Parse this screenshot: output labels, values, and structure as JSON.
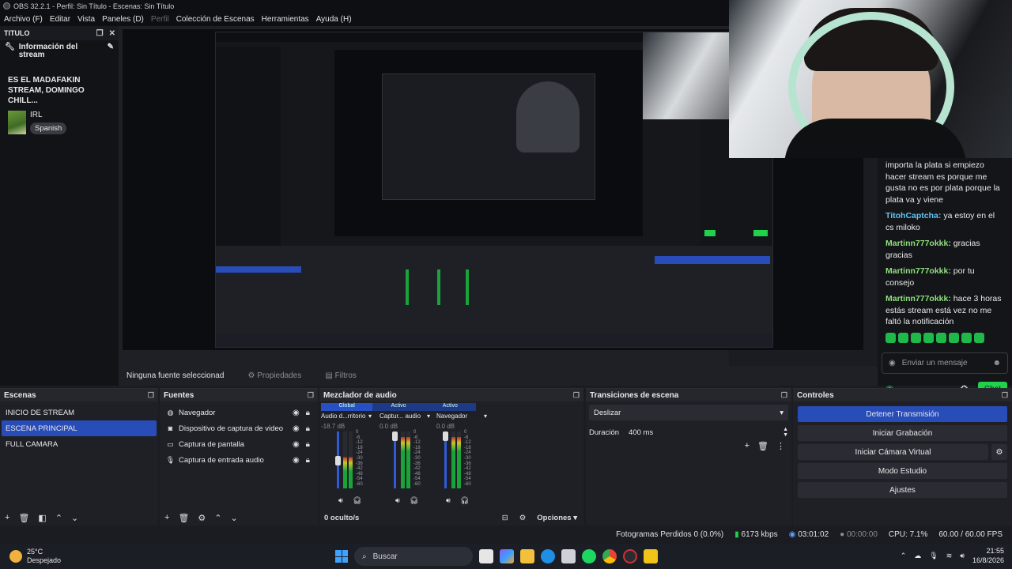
{
  "titlebar": {
    "title": "OBS 32.2.1 - Perfil: Sin Título - Escenas: Sin Título"
  },
  "menu": [
    "Archivo (F)",
    "Editar",
    "Vista",
    "Paneles (D)",
    "Perfil",
    "Colección de Escenas",
    "Herramientas",
    "Ayuda (H)"
  ],
  "leftdock": {
    "header": "TITULO",
    "info_title": "Información del stream",
    "stream_title": "ES EL MADAFAKIN STREAM, DOMINGO CHILL...",
    "category": "IRL",
    "language": "Spanish"
  },
  "chat": {
    "messages": [
      {
        "user": "",
        "text": "importa la plata si empiezo hacer stream es porque me gusta no es por plata porque la plata va y viene"
      },
      {
        "user": "TitohCaptcha",
        "text": "ya estoy en el cs miloko",
        "color": "#61c3f0"
      },
      {
        "user": "Martinn777okkk",
        "text": "gracias gracias"
      },
      {
        "user": "Martinn777okkk",
        "text": "por tu consejo"
      },
      {
        "user": "Martinn777okkk",
        "text": "hace 3 horas estás stream está vez no me faltó la notificación"
      }
    ],
    "input_placeholder": "Enviar un mensaje",
    "chat_button": "Chat"
  },
  "subbar": {
    "no_source": "Ninguna fuente seleccionad",
    "properties": "Propiedades",
    "filters": "Filtros"
  },
  "scenes": {
    "title": "Escenas",
    "items": [
      "INICIO DE STREAM",
      "ESCENA PRINCIPAL",
      "FULL CAMARA"
    ],
    "selected": "ESCENA PRINCIPAL"
  },
  "sources": {
    "title": "Fuentes",
    "items": [
      {
        "label": "Navegador",
        "icon": "globe-icon"
      },
      {
        "label": "Dispositivo de captura de video",
        "icon": "camera-icon"
      },
      {
        "label": "Captura de pantalla",
        "icon": "monitor-icon"
      },
      {
        "label": "Captura de entrada audio",
        "icon": "mic-icon"
      }
    ]
  },
  "mixer": {
    "title": "Mezclador de audio",
    "tabs": [
      "Global",
      "Activo",
      "Activo"
    ],
    "channels": [
      {
        "name": "Audio d...rritorio",
        "db": "-18.7 dB",
        "level": 0.55
      },
      {
        "name": "Captur... audio",
        "db": "0.0 dB",
        "level": 0.9
      },
      {
        "name": "Navegador",
        "db": "0.0 dB",
        "level": 0.9
      }
    ],
    "ticks": [
      "0",
      "-6",
      "-12",
      "-18",
      "-24",
      "-30",
      "-36",
      "-42",
      "-48",
      "-54",
      "-60"
    ],
    "hidden": "0 oculto/s",
    "options": "Opciones"
  },
  "transitions": {
    "title": "Transiciones de escena",
    "selected": "Deslizar",
    "duration_label": "Duración",
    "duration_value": "400 ms"
  },
  "controls": {
    "title": "Controles",
    "buttons": [
      "Detener Transmisión",
      "Iniciar Grabación",
      "Iniciar Cámara Virtual",
      "Modo Estudio",
      "Ajustes"
    ]
  },
  "status": {
    "dropped": "Fotogramas Perdidos 0 (0.0%)",
    "bitrate": "6173 kbps",
    "stream_time": "03:01:02",
    "rec_time": "00:00:00",
    "cpu": "CPU: 7.1%",
    "fps": "60.00 / 60.00 FPS"
  },
  "taskbar": {
    "temp": "25°C",
    "weather": "Despejado",
    "search": "Buscar",
    "time": "21:55",
    "date": "16/8/2026"
  },
  "colors": {
    "accent": "#284cb8",
    "live": "#1fd24a",
    "bg": "#1f2026"
  }
}
